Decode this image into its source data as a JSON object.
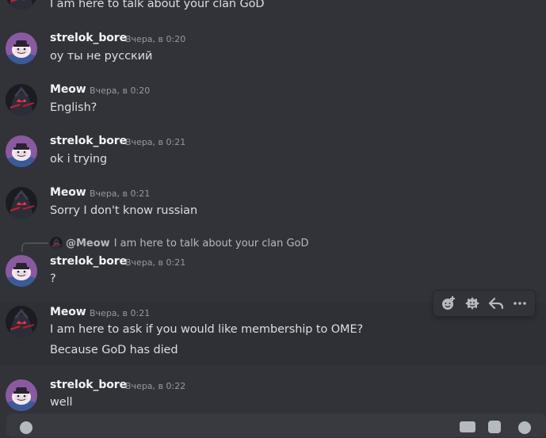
{
  "messages": [
    {
      "author": "",
      "timestamp": "",
      "lines": [
        "I am here to talk about your clan GoD"
      ],
      "avatar": "meow"
    },
    {
      "author": "strelok_bore",
      "timestamp": "Вчера, в 0:20",
      "lines": [
        "оу ты не русский"
      ],
      "avatar": "strelok"
    },
    {
      "author": "Meow",
      "timestamp": "Вчера, в 0:20",
      "lines": [
        "English?"
      ],
      "avatar": "meow"
    },
    {
      "author": "strelok_bore",
      "timestamp": "Вчера, в 0:21",
      "lines": [
        "ok i trying"
      ],
      "avatar": "strelok"
    },
    {
      "author": "Meow",
      "timestamp": "Вчера, в 0:21",
      "lines": [
        "Sorry I don't know russian"
      ],
      "avatar": "meow"
    },
    {
      "author": "strelok_bore",
      "timestamp": "Вчера, в 0:21",
      "lines": [
        "?"
      ],
      "avatar": "strelok",
      "reply": {
        "mention": "@Meow",
        "text": "I am here to talk about your clan GoD"
      }
    },
    {
      "author": "Meow",
      "timestamp": "Вчера, в 0:21",
      "lines": [
        "I am here to ask if you would like membership to OME?",
        "Because GoD has died"
      ],
      "avatar": "meow"
    },
    {
      "author": "strelok_bore",
      "timestamp": "Вчера, в 0:22",
      "lines": [
        "well"
      ],
      "avatar": "strelok"
    }
  ],
  "toolbar": {
    "icons": [
      "add-reaction-icon",
      "super-reaction-icon",
      "reply-icon",
      "more-icon"
    ]
  },
  "colors": {
    "background": "#313338",
    "hover": "#2e3035",
    "author": "#f2f3f5",
    "text": "#dbdee1",
    "timestamp": "#949ba4"
  }
}
